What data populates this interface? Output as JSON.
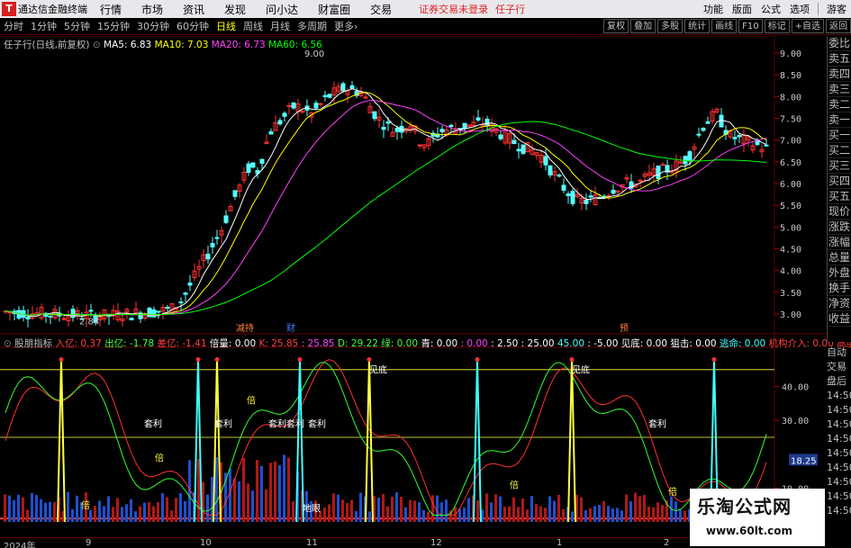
{
  "titlebar": {
    "app_name": "通达信金融终端",
    "menus": [
      "行情",
      "市场",
      "资讯",
      "发现",
      "问小达",
      "财富圈",
      "交易"
    ],
    "warning": "证券交易未登录",
    "stock_name": "任子行",
    "right_items": [
      "功能",
      "版面",
      "公式",
      "选项"
    ],
    "guest": "游客"
  },
  "toolbar": {
    "periods": [
      "分时",
      "1分钟",
      "5分钟",
      "15分钟",
      "30分钟",
      "60分钟",
      "日线",
      "周线",
      "月线",
      "多周期",
      "更多"
    ],
    "active_period": "日线",
    "right_buttons": [
      "复权",
      "叠加",
      "多股",
      "统计",
      "画线",
      "F10",
      "标记",
      "+自选",
      "返回"
    ]
  },
  "price_info": {
    "title": "任子行(日线,前复权)",
    "ma5": "MA5: 6.83",
    "ma10": "MA10: 7.03",
    "ma20": "MA20: 6.73",
    "ma60": "MA60: 6.56",
    "high_label": "9.00",
    "low_label": "2.84"
  },
  "price_axis": [
    "9.00",
    "8.50",
    "8.00",
    "7.50",
    "7.00",
    "6.50",
    "6.00",
    "5.50",
    "5.00",
    "4.50",
    "4.00",
    "3.50",
    "3.00"
  ],
  "event_markers": [
    "减持",
    "财",
    "预"
  ],
  "indicator_info": {
    "name": "股朋指标",
    "items": [
      {
        "text": "入亿: 0.37",
        "color": "#ff4040"
      },
      {
        "text": "出亿: -1.78",
        "color": "#40ff40"
      },
      {
        "text": "差亿: -1.41",
        "color": "#ff4040"
      },
      {
        "text": "倍量: 0.00",
        "color": "#ffffff"
      },
      {
        "text": "K: 25.85",
        "color": "#ff4040"
      },
      {
        "text": ": 25.85",
        "color": "#ff40ff"
      },
      {
        "text": "D: 29.22",
        "color": "#40ff40"
      },
      {
        "text": "绿: 0.00",
        "color": "#40ff40"
      },
      {
        "text": "青: 0.00",
        "color": "#ffffff"
      },
      {
        "text": ": 0.00",
        "color": "#ff40ff"
      },
      {
        "text": ": 2.50",
        "color": "#ffffff"
      },
      {
        "text": ": 25.00",
        "color": "#ffffff"
      },
      {
        "text": "45.00",
        "color": "#40ffff"
      },
      {
        "text": ": -5.00",
        "color": "#ffffff"
      },
      {
        "text": "见底: 0.00",
        "color": "#ffffff"
      },
      {
        "text": "狙击: 0.00",
        "color": "#ffffff"
      },
      {
        "text": "逃命: 0.00",
        "color": "#40ffff"
      },
      {
        "text": "机构介入: 0.00",
        "color": "#ff4040"
      },
      {
        "text": "高度控",
        "color": "#ff4040"
      }
    ]
  },
  "indicator_axis": [
    "40.00",
    "30.00",
    "10.00"
  ],
  "indicator_current": "18.25",
  "indicator_labels": [
    "见底",
    "见底",
    "套利",
    "套利",
    "套利",
    "套利",
    "套利",
    "套利",
    "倍",
    "倍",
    "倍",
    "倍",
    "倍",
    "地眼"
  ],
  "right_panel": [
    "委比",
    "卖五",
    "卖四",
    "卖三",
    "卖二",
    "卖一",
    "买一",
    "买二",
    "买三",
    "买四",
    "买五",
    "现价",
    "涨跌",
    "涨幅",
    "总量",
    "外盘",
    "换手",
    "净资",
    "收益"
  ],
  "right_panel2": [
    "自动",
    "交易",
    "盘后",
    "14:50",
    "14:50",
    "14:50",
    "14:50",
    "14:50",
    "14:50",
    "14:50",
    "14:50",
    "14:50"
  ],
  "x_axis": [
    "2024年",
    "9",
    "10",
    "11",
    "12",
    "1",
    "2"
  ],
  "watermark": {
    "title": "乐淘公式网",
    "url": "www.60lt.com"
  },
  "colors": {
    "up": "#ff3232",
    "down": "#54ffff",
    "ma5": "#ffffff",
    "ma10": "#ffff00",
    "ma20": "#ff40ff",
    "ma60": "#00ff00"
  }
}
